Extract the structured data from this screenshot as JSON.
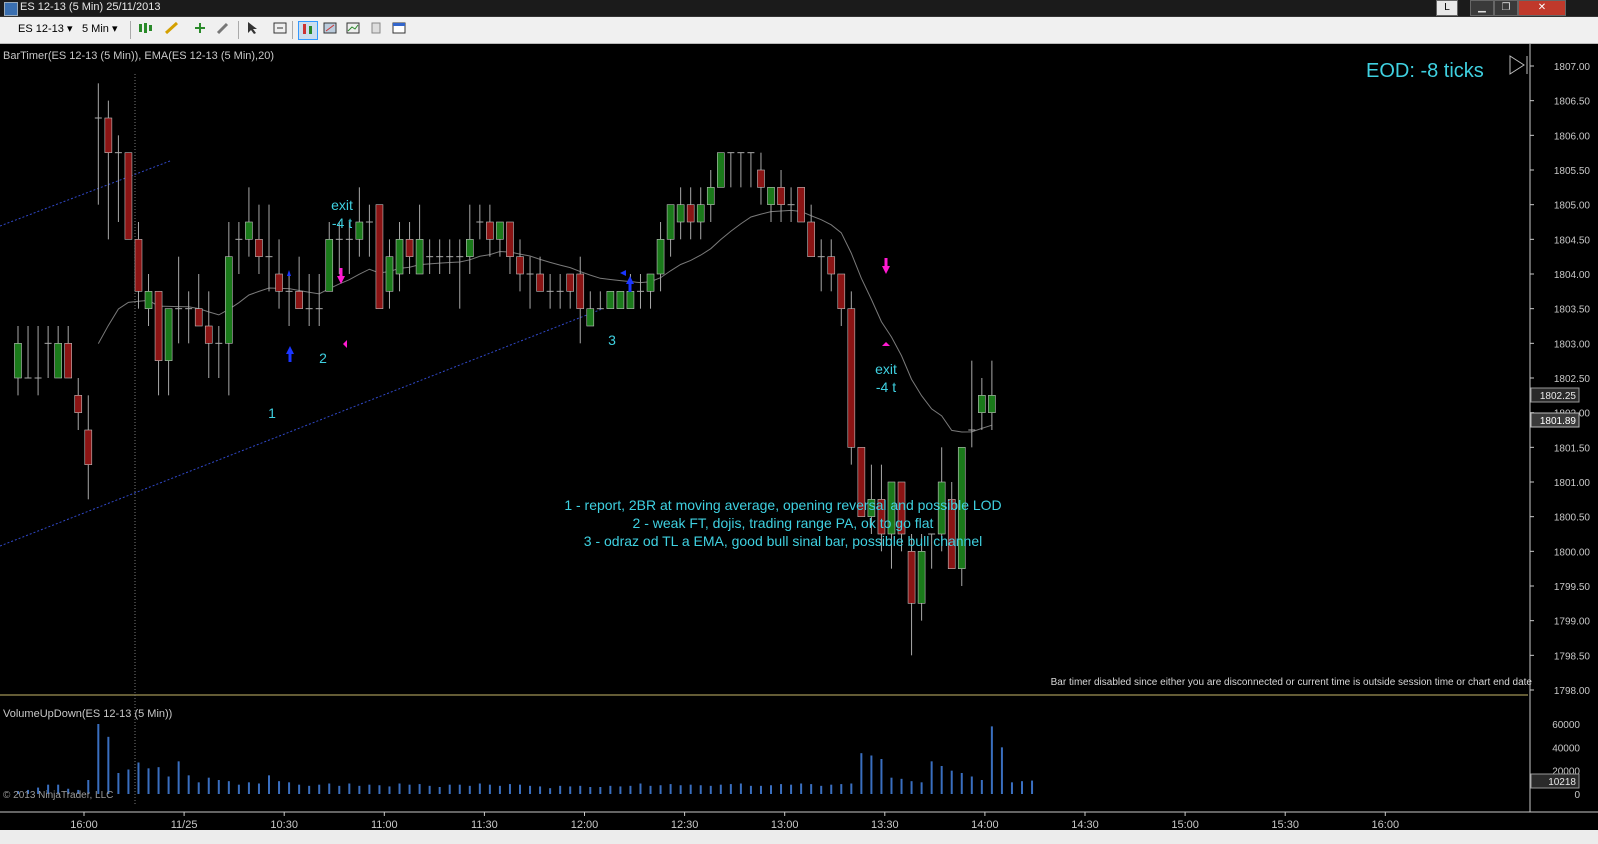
{
  "window": {
    "title": "ES 12-13 (5 Min)  25/11/2013",
    "linked_label": "L",
    "minimize": "▁",
    "restore": "❐",
    "close": "✕"
  },
  "toolbar": {
    "instrument": "ES 12-13",
    "interval": "5 Min",
    "dropdown_glyph": "▾",
    "chart_style_icon": "bar-style-icon",
    "draw_icon": "pencil-icon",
    "add_icon": "add-icon",
    "properties_icon": "wrench-icon",
    "cursor_icon": "cursor-icon",
    "zoom_icon": "zoom-icon",
    "indicators_icon": "indicators-icon",
    "strategies_icon": "strategies-icon",
    "data_box_icon": "data-box-icon",
    "alert_icon": "alert-icon",
    "properties2_icon": "properties-icon"
  },
  "chart": {
    "indicator_label": "BarTimer(ES 12-13 (5 Min)), EMA(ES 12-13 (5 Min),20)",
    "eod_text": "EOD: -8 ticks",
    "bar_timer_msg": "Bar timer disabled since either you are disconnected or current time is outside session time or chart end date",
    "volume_label": "VolumeUpDown(ES 12-13 (5 Min))",
    "copyright": "© 2013 NinjaTrader, LLC",
    "notes": [
      "1 - report, 2BR at moving average, opening reversal and possible LOD",
      "2 - weak FT, dojis, trading range PA, ok to go flat",
      "3 - odraz od TL a EMA, good bull sinal bar, possible bull channel"
    ],
    "exit_labels": [
      "exit",
      "-4 t"
    ],
    "numbers": [
      "1",
      "2",
      "3"
    ],
    "last_price": "1802.25",
    "ema_price": "1801.89",
    "last_volume": "10218",
    "colors": {
      "bg": "#000000",
      "up": "#1a7a1a",
      "down": "#8b1414",
      "wick": "#a8a8a8",
      "cyan": "#3fd1e1",
      "magenta": "#ff1ad1",
      "blue": "#1a35ff",
      "trendline": "#3048c8",
      "ema": "#7a7a7a",
      "volume": "#3a6fc0"
    }
  },
  "chart_data": {
    "type": "candlestick",
    "price_axis": {
      "min": 1798.0,
      "max": 1807.0,
      "ticks": [
        "1807.00",
        "1806.50",
        "1806.00",
        "1805.50",
        "1805.00",
        "1804.50",
        "1804.00",
        "1803.50",
        "1803.00",
        "1802.50",
        "1802.00",
        "1801.50",
        "1801.00",
        "1800.50",
        "1800.00",
        "1799.50",
        "1799.00",
        "1798.50",
        "1798.00"
      ]
    },
    "time_ticks": [
      "16:00",
      "11/25",
      "10:30",
      "11:00",
      "11:30",
      "12:00",
      "12:30",
      "13:00",
      "13:30",
      "14:00",
      "14:30",
      "15:00",
      "15:30",
      "16:00"
    ],
    "volume_axis": {
      "min": 0,
      "max": 60000,
      "ticks": [
        "60000",
        "40000",
        "20000",
        "0"
      ]
    },
    "candles": [
      {
        "o": 1802.5,
        "h": 1803.25,
        "l": 1802.25,
        "c": 1803.0
      },
      {
        "o": 1802.5,
        "h": 1803.25,
        "l": 1802.5,
        "c": 1802.5
      },
      {
        "o": 1802.5,
        "h": 1803.25,
        "l": 1802.25,
        "c": 1802.5
      },
      {
        "o": 1803.0,
        "h": 1803.25,
        "l": 1802.5,
        "c": 1803.0
      },
      {
        "o": 1802.5,
        "h": 1803.25,
        "l": 1802.5,
        "c": 1803.0
      },
      {
        "o": 1803.0,
        "h": 1803.25,
        "l": 1802.5,
        "c": 1802.5
      },
      {
        "o": 1802.25,
        "h": 1802.5,
        "l": 1801.75,
        "c": 1802.0
      },
      {
        "o": 1801.75,
        "h": 1802.25,
        "l": 1800.75,
        "c": 1801.25
      },
      {
        "o": 1806.25,
        "h": 1806.75,
        "l": 1805.0,
        "c": 1806.25
      },
      {
        "o": 1806.25,
        "h": 1806.5,
        "l": 1804.5,
        "c": 1805.75
      },
      {
        "o": 1805.75,
        "h": 1806.0,
        "l": 1804.75,
        "c": 1805.75
      },
      {
        "o": 1805.75,
        "h": 1805.75,
        "l": 1804.5,
        "c": 1804.5
      },
      {
        "o": 1804.5,
        "h": 1804.75,
        "l": 1803.5,
        "c": 1803.75
      },
      {
        "o": 1803.5,
        "h": 1804.0,
        "l": 1803.25,
        "c": 1803.75
      },
      {
        "o": 1803.75,
        "h": 1803.75,
        "l": 1802.25,
        "c": 1802.75
      },
      {
        "o": 1802.75,
        "h": 1803.5,
        "l": 1802.25,
        "c": 1803.5
      },
      {
        "o": 1803.5,
        "h": 1804.25,
        "l": 1803.0,
        "c": 1803.5
      },
      {
        "o": 1803.5,
        "h": 1803.75,
        "l": 1803.0,
        "c": 1803.5
      },
      {
        "o": 1803.5,
        "h": 1804.0,
        "l": 1803.25,
        "c": 1803.25
      },
      {
        "o": 1803.25,
        "h": 1803.75,
        "l": 1802.5,
        "c": 1803.0
      },
      {
        "o": 1803.0,
        "h": 1803.25,
        "l": 1802.5,
        "c": 1803.0
      },
      {
        "o": 1803.0,
        "h": 1804.75,
        "l": 1802.25,
        "c": 1804.25
      },
      {
        "o": 1804.5,
        "h": 1804.75,
        "l": 1804.0,
        "c": 1804.5
      },
      {
        "o": 1804.5,
        "h": 1805.25,
        "l": 1804.25,
        "c": 1804.75
      },
      {
        "o": 1804.5,
        "h": 1805.0,
        "l": 1804.0,
        "c": 1804.25
      },
      {
        "o": 1804.25,
        "h": 1805.0,
        "l": 1803.75,
        "c": 1804.25
      },
      {
        "o": 1804.0,
        "h": 1804.5,
        "l": 1803.5,
        "c": 1803.75
      },
      {
        "o": 1803.75,
        "h": 1804.0,
        "l": 1803.25,
        "c": 1803.75
      },
      {
        "o": 1803.75,
        "h": 1804.25,
        "l": 1803.5,
        "c": 1803.5
      },
      {
        "o": 1803.5,
        "h": 1804.0,
        "l": 1803.25,
        "c": 1803.5
      },
      {
        "o": 1803.5,
        "h": 1804.0,
        "l": 1803.25,
        "c": 1803.5
      },
      {
        "o": 1803.75,
        "h": 1804.75,
        "l": 1803.75,
        "c": 1804.5
      },
      {
        "o": 1804.5,
        "h": 1804.75,
        "l": 1804.0,
        "c": 1804.5
      },
      {
        "o": 1804.5,
        "h": 1804.75,
        "l": 1804.0,
        "c": 1804.5
      },
      {
        "o": 1804.5,
        "h": 1805.25,
        "l": 1804.25,
        "c": 1804.75
      },
      {
        "o": 1804.75,
        "h": 1805.0,
        "l": 1804.25,
        "c": 1804.75
      },
      {
        "o": 1805.0,
        "h": 1805.0,
        "l": 1803.5,
        "c": 1803.5
      },
      {
        "o": 1803.75,
        "h": 1804.5,
        "l": 1803.5,
        "c": 1804.25
      },
      {
        "o": 1804.0,
        "h": 1804.75,
        "l": 1803.75,
        "c": 1804.5
      },
      {
        "o": 1804.5,
        "h": 1804.75,
        "l": 1804.0,
        "c": 1804.25
      },
      {
        "o": 1804.0,
        "h": 1805.0,
        "l": 1804.0,
        "c": 1804.5
      },
      {
        "o": 1804.25,
        "h": 1804.5,
        "l": 1804.0,
        "c": 1804.25
      },
      {
        "o": 1804.25,
        "h": 1804.5,
        "l": 1804.0,
        "c": 1804.25
      },
      {
        "o": 1804.25,
        "h": 1804.5,
        "l": 1804.0,
        "c": 1804.25
      },
      {
        "o": 1804.25,
        "h": 1804.5,
        "l": 1803.5,
        "c": 1804.25
      },
      {
        "o": 1804.25,
        "h": 1805.0,
        "l": 1804.0,
        "c": 1804.5
      },
      {
        "o": 1804.75,
        "h": 1805.0,
        "l": 1804.5,
        "c": 1804.75
      },
      {
        "o": 1804.75,
        "h": 1805.0,
        "l": 1804.25,
        "c": 1804.5
      },
      {
        "o": 1804.5,
        "h": 1804.75,
        "l": 1804.25,
        "c": 1804.75
      },
      {
        "o": 1804.75,
        "h": 1804.75,
        "l": 1804.0,
        "c": 1804.25
      },
      {
        "o": 1804.25,
        "h": 1804.5,
        "l": 1803.75,
        "c": 1804.0
      },
      {
        "o": 1804.0,
        "h": 1804.25,
        "l": 1803.5,
        "c": 1804.0
      },
      {
        "o": 1804.0,
        "h": 1804.25,
        "l": 1803.75,
        "c": 1803.75
      },
      {
        "o": 1803.75,
        "h": 1804.0,
        "l": 1803.5,
        "c": 1803.75
      },
      {
        "o": 1803.75,
        "h": 1804.0,
        "l": 1803.5,
        "c": 1803.75
      },
      {
        "o": 1804.0,
        "h": 1804.0,
        "l": 1803.5,
        "c": 1803.75
      },
      {
        "o": 1804.0,
        "h": 1804.25,
        "l": 1803.0,
        "c": 1803.5
      },
      {
        "o": 1803.25,
        "h": 1803.75,
        "l": 1803.25,
        "c": 1803.5
      },
      {
        "o": 1803.5,
        "h": 1803.75,
        "l": 1803.5,
        "c": 1803.5
      },
      {
        "o": 1803.5,
        "h": 1803.75,
        "l": 1803.5,
        "c": 1803.75
      },
      {
        "o": 1803.5,
        "h": 1803.75,
        "l": 1803.5,
        "c": 1803.75
      },
      {
        "o": 1803.5,
        "h": 1804.0,
        "l": 1803.5,
        "c": 1803.75
      },
      {
        "o": 1803.75,
        "h": 1804.0,
        "l": 1803.5,
        "c": 1803.75
      },
      {
        "o": 1803.75,
        "h": 1804.0,
        "l": 1803.5,
        "c": 1804.0
      },
      {
        "o": 1804.0,
        "h": 1804.75,
        "l": 1803.75,
        "c": 1804.5
      },
      {
        "o": 1804.5,
        "h": 1805.0,
        "l": 1804.25,
        "c": 1805.0
      },
      {
        "o": 1804.75,
        "h": 1805.25,
        "l": 1804.5,
        "c": 1805.0
      },
      {
        "o": 1805.0,
        "h": 1805.25,
        "l": 1804.5,
        "c": 1804.75
      },
      {
        "o": 1804.75,
        "h": 1805.25,
        "l": 1804.5,
        "c": 1805.0
      },
      {
        "o": 1805.0,
        "h": 1805.5,
        "l": 1804.75,
        "c": 1805.25
      },
      {
        "o": 1805.25,
        "h": 1805.75,
        "l": 1805.25,
        "c": 1805.75
      },
      {
        "o": 1805.75,
        "h": 1805.75,
        "l": 1805.25,
        "c": 1805.75
      },
      {
        "o": 1805.75,
        "h": 1805.75,
        "l": 1805.25,
        "c": 1805.75
      },
      {
        "o": 1805.75,
        "h": 1805.75,
        "l": 1805.25,
        "c": 1805.75
      },
      {
        "o": 1805.5,
        "h": 1805.75,
        "l": 1805.0,
        "c": 1805.25
      },
      {
        "o": 1805.0,
        "h": 1805.25,
        "l": 1804.75,
        "c": 1805.25
      },
      {
        "o": 1805.25,
        "h": 1805.5,
        "l": 1804.75,
        "c": 1805.0
      },
      {
        "o": 1805.0,
        "h": 1805.25,
        "l": 1804.75,
        "c": 1805.0
      },
      {
        "o": 1805.25,
        "h": 1805.25,
        "l": 1804.75,
        "c": 1804.75
      },
      {
        "o": 1804.75,
        "h": 1805.0,
        "l": 1804.25,
        "c": 1804.25
      },
      {
        "o": 1804.25,
        "h": 1804.5,
        "l": 1803.75,
        "c": 1804.25
      },
      {
        "o": 1804.25,
        "h": 1804.5,
        "l": 1803.75,
        "c": 1804.0
      },
      {
        "o": 1804.0,
        "h": 1804.0,
        "l": 1803.25,
        "c": 1803.5
      },
      {
        "o": 1803.5,
        "h": 1803.75,
        "l": 1801.25,
        "c": 1801.5
      },
      {
        "o": 1801.5,
        "h": 1801.5,
        "l": 1800.5,
        "c": 1800.5
      },
      {
        "o": 1800.5,
        "h": 1801.25,
        "l": 1800.25,
        "c": 1800.75
      },
      {
        "o": 1800.75,
        "h": 1801.25,
        "l": 1800.0,
        "c": 1800.25
      },
      {
        "o": 1800.25,
        "h": 1801.0,
        "l": 1799.75,
        "c": 1801.0
      },
      {
        "o": 1801.0,
        "h": 1801.0,
        "l": 1800.0,
        "c": 1800.25
      },
      {
        "o": 1800.0,
        "h": 1800.25,
        "l": 1798.5,
        "c": 1799.25
      },
      {
        "o": 1799.25,
        "h": 1800.25,
        "l": 1799.0,
        "c": 1800.0
      },
      {
        "o": 1800.25,
        "h": 1800.25,
        "l": 1799.75,
        "c": 1800.25
      },
      {
        "o": 1800.25,
        "h": 1801.5,
        "l": 1800.0,
        "c": 1801.0
      },
      {
        "o": 1800.75,
        "h": 1801.0,
        "l": 1799.75,
        "c": 1799.75
      },
      {
        "o": 1799.75,
        "h": 1801.5,
        "l": 1799.5,
        "c": 1801.5
      },
      {
        "o": 1801.75,
        "h": 1802.75,
        "l": 1801.5,
        "c": 1801.75
      },
      {
        "o": 1802.0,
        "h": 1802.5,
        "l": 1801.75,
        "c": 1802.25
      },
      {
        "o": 1802.0,
        "h": 1802.75,
        "l": 1801.75,
        "c": 1802.25
      }
    ],
    "volumes": [
      2500,
      3500,
      5500,
      8000,
      8000,
      4500,
      3500,
      12000,
      60000,
      49000,
      18000,
      21000,
      27000,
      22000,
      23000,
      15000,
      28000,
      16000,
      10000,
      14000,
      12000,
      11000,
      8000,
      10000,
      9000,
      16000,
      11000,
      10000,
      8000,
      7000,
      8000,
      9000,
      7000,
      9000,
      7000,
      8000,
      7500,
      6500,
      9000,
      8000,
      8500,
      7000,
      6000,
      8000,
      8000,
      7000,
      9000,
      8000,
      7000,
      8500,
      8000,
      7000,
      6500,
      5000,
      7000,
      6500,
      7000,
      6000,
      6000,
      7000,
      6500,
      7000,
      9000,
      7000,
      7500,
      8500,
      7500,
      8000,
      7500,
      7000,
      8000,
      8500,
      9000,
      7000,
      7000,
      7500,
      8500,
      8000,
      9000,
      8500,
      7000,
      8000,
      8500,
      9000,
      35000,
      33000,
      30000,
      14000,
      13000,
      11000,
      10000,
      28000,
      24000,
      20000,
      18000,
      15000,
      12000,
      58000,
      40000,
      10000,
      11000,
      11500
    ]
  }
}
